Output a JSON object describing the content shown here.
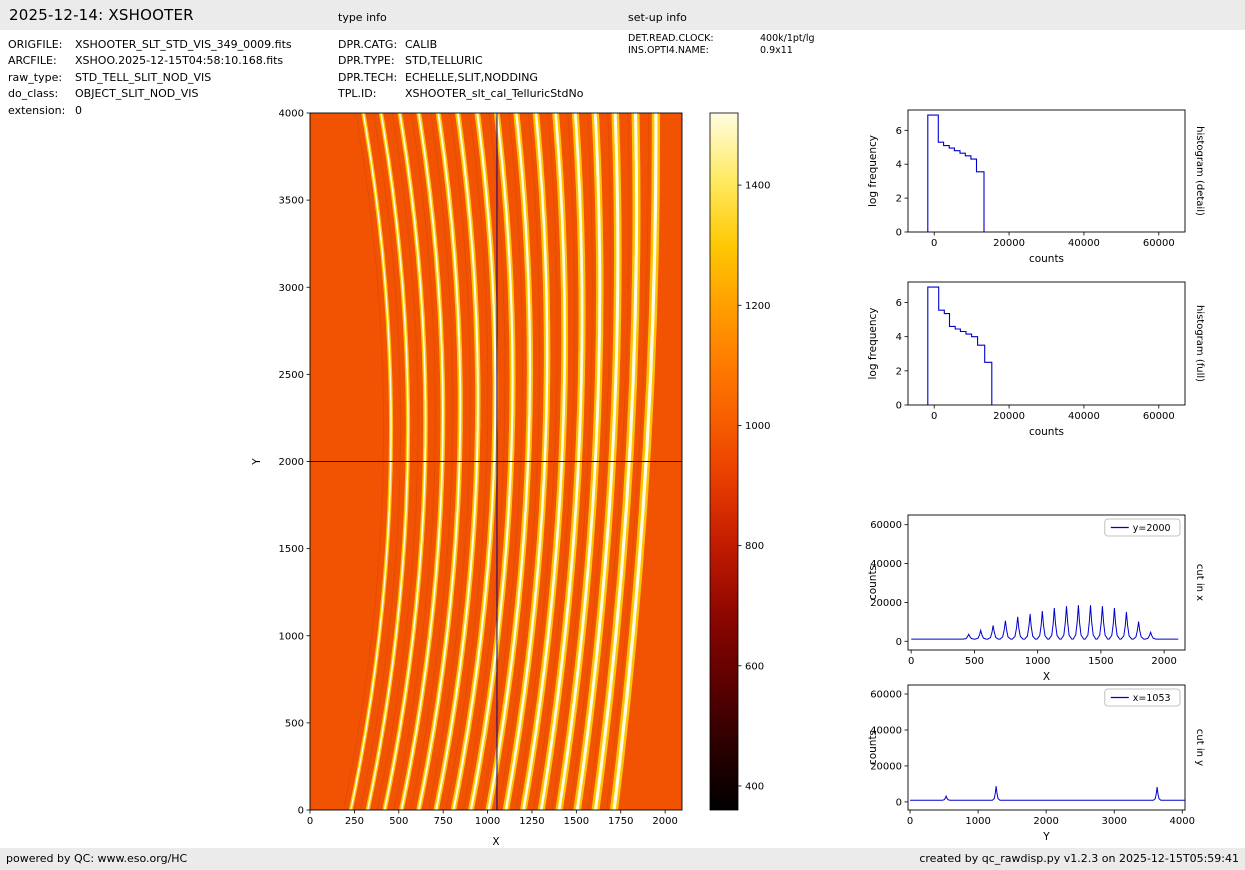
{
  "header": {
    "title": "2025-12-14: XSHOOTER",
    "type_info_label": "type info",
    "setup_info_label": "set-up info"
  },
  "file_info": [
    {
      "label": "ORIGFILE:",
      "value": "XSHOOTER_SLT_STD_VIS_349_0009.fits"
    },
    {
      "label": "ARCFILE:",
      "value": "XSHOO.2025-12-15T04:58:10.168.fits"
    },
    {
      "label": "raw_type:",
      "value": "STD_TELL_SLIT_NOD_VIS"
    },
    {
      "label": "do_class:",
      "value": "OBJECT_SLIT_NOD_VIS"
    },
    {
      "label": "extension:",
      "value": "0"
    }
  ],
  "type_info": [
    {
      "label": "DPR.CATG:",
      "value": "CALIB"
    },
    {
      "label": "DPR.TYPE:",
      "value": "STD,TELLURIC"
    },
    {
      "label": "DPR.TECH:",
      "value": "ECHELLE,SLIT,NODDING"
    },
    {
      "label": "TPL.ID:",
      "value": "XSHOOTER_slt_cal_TelluricStdNo"
    }
  ],
  "setup_info": [
    {
      "label": "DET.READ.CLOCK:",
      "value": "400k/1pt/lg"
    },
    {
      "label": "INS.OPTI4.NAME:",
      "value": "0.9x11"
    }
  ],
  "footer": {
    "left": "powered by QC: www.eso.org/HC",
    "right": "created by qc_rawdisp.py v1.2.3 on 2025-12-15T05:59:41"
  },
  "chart_data": [
    {
      "id": "raw-image",
      "type": "heatmap",
      "title": "raw echelle frame with crosshair",
      "xlabel": "X",
      "ylabel": "Y",
      "xlim": [
        0,
        2095
      ],
      "ylim": [
        0,
        4000
      ],
      "xticks": [
        0,
        250,
        500,
        750,
        1000,
        1250,
        1500,
        1750,
        2000
      ],
      "yticks": [
        0,
        500,
        1000,
        1500,
        2000,
        2500,
        3000,
        3500,
        4000
      ],
      "axes": [
        310,
        113,
        372,
        697
      ],
      "xlabel_offset": 35,
      "ylabel_offset": -50,
      "background_color": "#f25303",
      "order_glow_color": "#ffc400",
      "order_core_color": "#fffbe6",
      "order_faint_color": "#d64500",
      "crosshair": {
        "x": 1053,
        "y": 2000,
        "color": "#00008b"
      },
      "orders": [
        [
          230,
          455,
          300
        ],
        [
          325,
          550,
          400
        ],
        [
          420,
          648,
          505
        ],
        [
          515,
          745,
          612
        ],
        [
          612,
          842,
          722
        ],
        [
          710,
          940,
          832
        ],
        [
          808,
          1037,
          942
        ],
        [
          906,
          1132,
          1052
        ],
        [
          1005,
          1228,
          1162
        ],
        [
          1103,
          1322,
          1272
        ],
        [
          1202,
          1418,
          1383
        ],
        [
          1302,
          1512,
          1494
        ],
        [
          1403,
          1607,
          1606
        ],
        [
          1505,
          1702,
          1719
        ],
        [
          1608,
          1798,
          1833
        ],
        [
          1712,
          1893,
          1948
        ]
      ]
    },
    {
      "id": "colorbar",
      "type": "colorbar",
      "axes": [
        710,
        113,
        28,
        697
      ],
      "vmin": 360,
      "vmax": 1520,
      "ticks": [
        400,
        600,
        800,
        1000,
        1200,
        1400
      ],
      "stops": [
        [
          0,
          "#000000"
        ],
        [
          0.07,
          "#200000"
        ],
        [
          0.17,
          "#560000"
        ],
        [
          0.28,
          "#8e0600"
        ],
        [
          0.38,
          "#c21c00"
        ],
        [
          0.48,
          "#ea3f00"
        ],
        [
          0.56,
          "#f75e00"
        ],
        [
          0.64,
          "#ff7b00"
        ],
        [
          0.73,
          "#ffa200"
        ],
        [
          0.81,
          "#ffc804"
        ],
        [
          0.9,
          "#ffe95e"
        ],
        [
          1,
          "#fffce0"
        ]
      ]
    },
    {
      "id": "hist-detail",
      "type": "step",
      "xlabel": "counts",
      "ylabel": "log frequency",
      "right_label": "histogram (detail)",
      "xlim": [
        -7000,
        67000
      ],
      "ylim": [
        0,
        7.2
      ],
      "xticks": [
        0,
        20000,
        40000,
        60000
      ],
      "yticks": [
        0,
        2,
        4,
        6
      ],
      "axes": [
        908,
        110,
        277,
        122
      ],
      "color": "#0000cd",
      "edges": [
        -1700,
        1100,
        2500,
        4000,
        5400,
        6900,
        8300,
        9800,
        11300,
        13300
      ],
      "levels": [
        6.9,
        5.3,
        5.1,
        4.95,
        4.8,
        4.65,
        4.5,
        4.3,
        3.55
      ]
    },
    {
      "id": "hist-full",
      "type": "step",
      "xlabel": "counts",
      "ylabel": "log frequency",
      "right_label": "histogram (full)",
      "xlim": [
        -7000,
        67000
      ],
      "ylim": [
        0,
        7.2
      ],
      "xticks": [
        0,
        20000,
        40000,
        60000
      ],
      "yticks": [
        0,
        2,
        4,
        6
      ],
      "axes": [
        908,
        282,
        277,
        123
      ],
      "color": "#0000cd",
      "edges": [
        -1700,
        1200,
        2700,
        4100,
        5600,
        7000,
        8500,
        10000,
        11600,
        13500,
        15400
      ],
      "levels": [
        6.9,
        5.55,
        5.35,
        4.6,
        4.45,
        4.3,
        4.15,
        4.0,
        3.5,
        2.5
      ]
    },
    {
      "id": "cut-x",
      "type": "cut",
      "xlabel": "X",
      "ylabel": "counts",
      "right_label": "cut in x",
      "legend": "y=2000",
      "xlim": [
        -25,
        2165
      ],
      "ylim": [
        -4500,
        65000
      ],
      "xticks": [
        0,
        500,
        1000,
        1500,
        2000
      ],
      "yticks": [
        0,
        20000,
        40000,
        60000
      ],
      "axes": [
        908,
        515,
        277,
        135
      ],
      "color": "#0000cd",
      "baseline": 1100,
      "span": [
        0,
        2112
      ],
      "peak_halfwidth": 42,
      "peaks": [
        [
          455,
          2500
        ],
        [
          550,
          4500
        ],
        [
          648,
          7000
        ],
        [
          745,
          9500
        ],
        [
          842,
          11500
        ],
        [
          940,
          13000
        ],
        [
          1037,
          14500
        ],
        [
          1132,
          16000
        ],
        [
          1228,
          17000
        ],
        [
          1322,
          17500
        ],
        [
          1418,
          17500
        ],
        [
          1512,
          17000
        ],
        [
          1607,
          16000
        ],
        [
          1702,
          14000
        ],
        [
          1798,
          9000
        ],
        [
          1893,
          3500
        ]
      ]
    },
    {
      "id": "cut-y",
      "type": "cut",
      "xlabel": "Y",
      "ylabel": "counts",
      "right_label": "cut in y",
      "legend": "x=1053",
      "xlim": [
        -30,
        4040
      ],
      "ylim": [
        -4500,
        65000
      ],
      "xticks": [
        0,
        1000,
        2000,
        3000,
        4000
      ],
      "yticks": [
        0,
        20000,
        40000,
        60000
      ],
      "axes": [
        908,
        685,
        277,
        125
      ],
      "color": "#0000cd",
      "baseline": 950,
      "span": [
        0,
        4035
      ],
      "peak_halfwidth": 55,
      "peaks": [
        [
          530,
          2300
        ],
        [
          1265,
          7800
        ],
        [
          3630,
          7300
        ]
      ]
    }
  ]
}
